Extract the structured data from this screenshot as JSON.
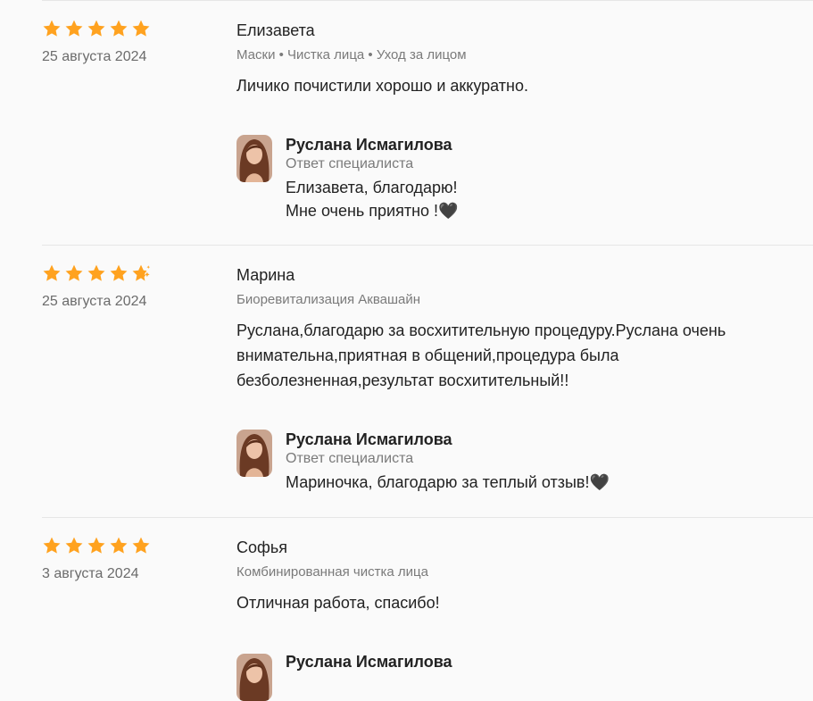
{
  "reviews": [
    {
      "rating": 5,
      "date": "25 августа 2024",
      "author": "Елизавета",
      "services": "Маски • Чистка лица • Уход за лицом",
      "text": "Личико почистили хорошо и аккуратно.",
      "reply": {
        "name": "Руслана Исмагилова",
        "role": "Ответ специалиста",
        "text": "Елизавета, благодарю!\nМне очень приятно !🖤"
      }
    },
    {
      "rating": 4.5,
      "date": "25 августа 2024",
      "author": "Марина",
      "services": "Биоревитализация Аквашайн",
      "text": "Руслана,благодарю за восхитительную процедуру.Руслана очень внимательна,приятная в общений,процедура была безболезненная,результат восхитительный!!",
      "reply": {
        "name": "Руслана Исмагилова",
        "role": "Ответ специалиста",
        "text": "Мариночка, благодарю за теплый отзыв!🖤"
      }
    },
    {
      "rating": 5,
      "date": "3 августа 2024",
      "author": "Софья",
      "services": "Комбинированная чистка лица",
      "text": "Отличная работа, спасибо!",
      "reply": {
        "name": "Руслана Исмагилова"
      }
    }
  ],
  "colors": {
    "star": "#ffa21f",
    "muted": "#7a7a7a",
    "divider": "#e6e6e6"
  },
  "icons": {
    "star": "star-icon",
    "half_star": "half-star-icon"
  }
}
